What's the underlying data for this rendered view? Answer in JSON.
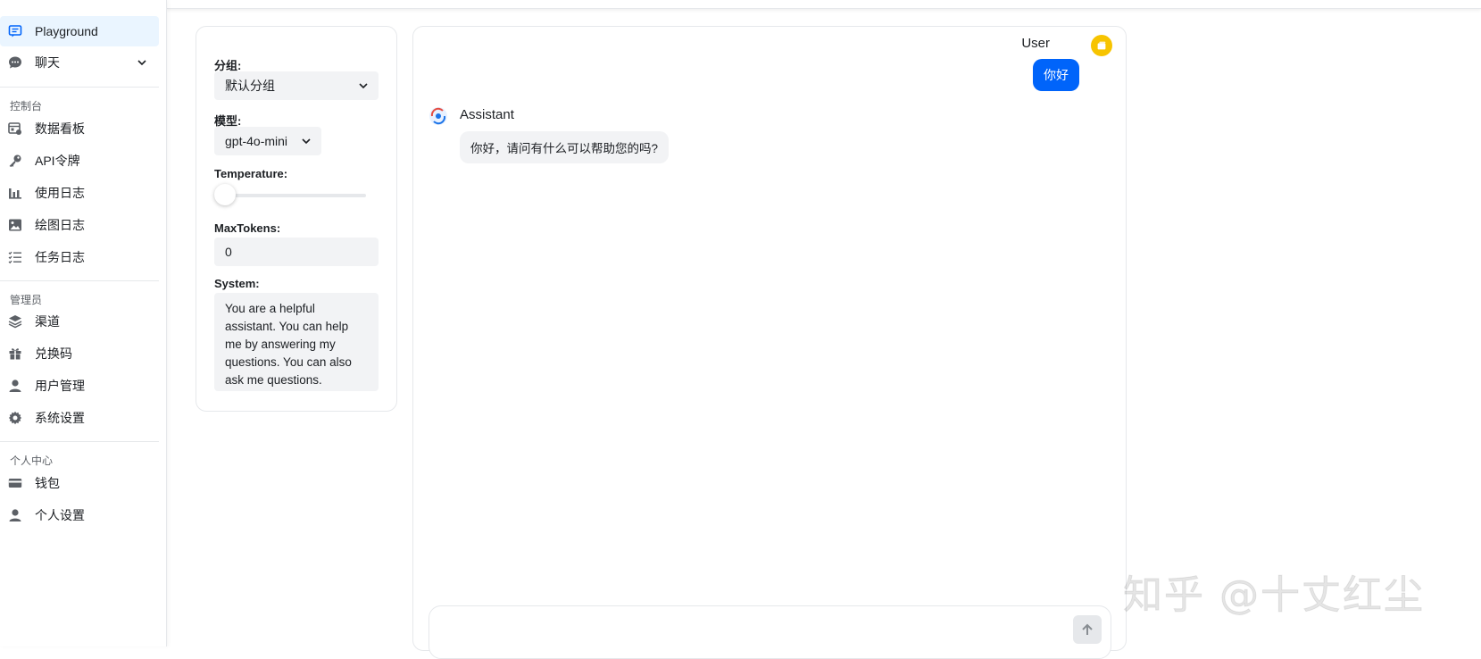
{
  "sidebar": {
    "top_items": [
      {
        "label": "Playground",
        "icon": "chat-square-icon",
        "active": true
      },
      {
        "label": "聊天",
        "icon": "chat-bubble-icon",
        "expandable": true
      }
    ],
    "sections": [
      {
        "title": "控制台",
        "items": [
          {
            "label": "数据看板",
            "icon": "dashboard-icon"
          },
          {
            "label": "API令牌",
            "icon": "key-icon"
          },
          {
            "label": "使用日志",
            "icon": "bar-chart-icon"
          },
          {
            "label": "绘图日志",
            "icon": "image-icon"
          },
          {
            "label": "任务日志",
            "icon": "task-list-icon"
          }
        ]
      },
      {
        "title": "管理员",
        "items": [
          {
            "label": "渠道",
            "icon": "layers-icon"
          },
          {
            "label": "兑换码",
            "icon": "gift-icon"
          },
          {
            "label": "用户管理",
            "icon": "user-icon"
          },
          {
            "label": "系统设置",
            "icon": "gear-icon"
          }
        ]
      },
      {
        "title": "个人中心",
        "items": [
          {
            "label": "钱包",
            "icon": "wallet-icon"
          },
          {
            "label": "个人设置",
            "icon": "user-icon"
          }
        ]
      }
    ]
  },
  "settings": {
    "group_label": "分组:",
    "group_value": "默认分组",
    "model_label": "模型:",
    "model_value": "gpt-4o-mini",
    "temperature_label": "Temperature:",
    "temperature_value": 0,
    "max_tokens_label": "MaxTokens:",
    "max_tokens_value": "0",
    "system_label": "System:",
    "system_value": "You are a helpful assistant. You can help me by answering my questions. You can also ask me questions."
  },
  "chat": {
    "user_name": "User",
    "user_message": "你好",
    "assistant_name": "Assistant",
    "assistant_message": "你好，请问有什么可以帮助您的吗?",
    "input_placeholder": ""
  },
  "watermark": "知乎 @十丈红尘",
  "colors": {
    "accent": "#0064fa",
    "active_nav_bg": "#eaf5ff",
    "avatar_user": "#f7c400",
    "field_bg": "#f2f3f5"
  }
}
